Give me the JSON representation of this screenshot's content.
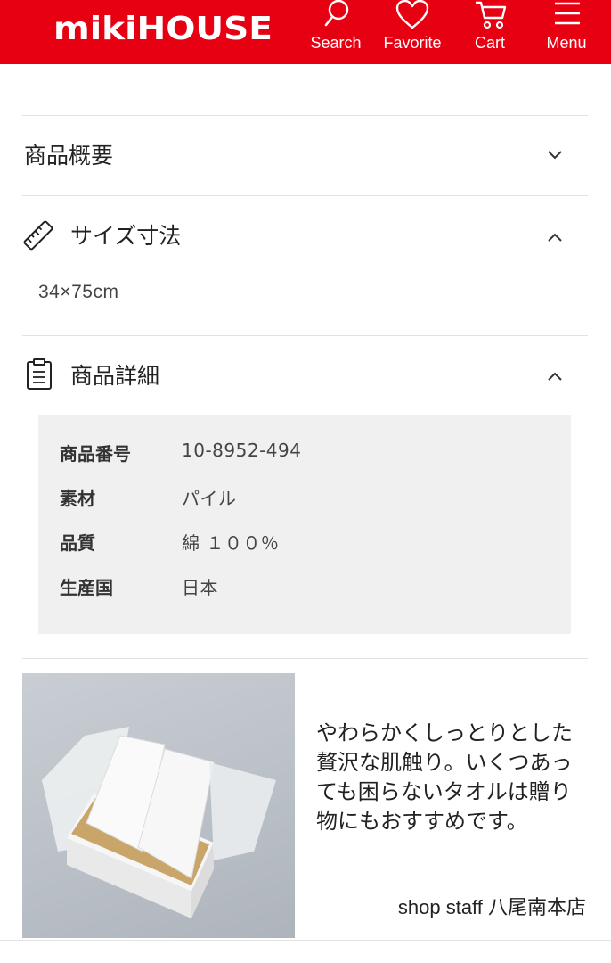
{
  "header": {
    "logo_text": "MIKI HOUSE",
    "brand_color": "#e60012",
    "nav": [
      {
        "label": "Search",
        "icon": "search-icon"
      },
      {
        "label": "Favorite",
        "icon": "heart-icon"
      },
      {
        "label": "Cart",
        "icon": "cart-icon"
      },
      {
        "label": "Menu",
        "icon": "menu-icon"
      }
    ]
  },
  "sections": {
    "overview": {
      "title": "商品概要",
      "expanded": false
    },
    "size": {
      "title": "サイズ寸法",
      "icon": "ruler-icon",
      "expanded": true,
      "value": "34×75cm"
    },
    "details": {
      "title": "商品詳細",
      "icon": "clipboard-icon",
      "expanded": true,
      "rows": [
        {
          "label": "商品番号",
          "value": "10-8952-494"
        },
        {
          "label": "素材",
          "value": "パイル"
        },
        {
          "label": "品質",
          "value": "綿 １００％"
        },
        {
          "label": "生産国",
          "value": "日本"
        }
      ]
    }
  },
  "staff_comment": {
    "text": "やわらかくしっとりとした贅沢な肌触り。いくつあっても困らないタオルは贈り物にもおすすめです。",
    "signature": "shop staff 八尾南本店"
  }
}
